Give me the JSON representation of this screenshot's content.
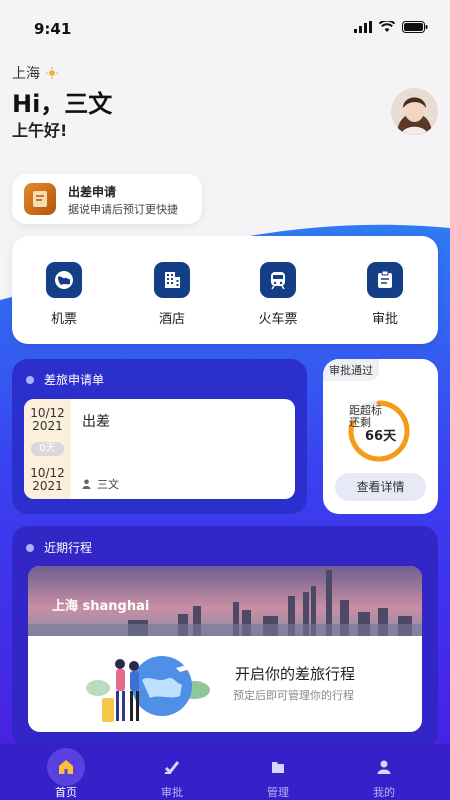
{
  "status": {
    "time": "9:41"
  },
  "header": {
    "location": "上海",
    "greeting": "Hi，三文",
    "subgreeting": "上午好!"
  },
  "apply": {
    "title": "出差申请",
    "subtitle": "据说申请后预订更快捷"
  },
  "services": [
    {
      "label": "机票",
      "icon": "globe-icon"
    },
    {
      "label": "酒店",
      "icon": "hotel-building-icon"
    },
    {
      "label": "火车票",
      "icon": "train-icon"
    },
    {
      "label": "审批",
      "icon": "clipboard-icon"
    }
  ],
  "trip_request": {
    "header": "差旅申请单",
    "start_date": "10/12",
    "start_year": "2021",
    "days": "0天",
    "end_date": "10/12",
    "end_year": "2021",
    "purpose": "出差",
    "person": "三文"
  },
  "approval": {
    "tag": "审批通过",
    "label_line1": "距超标",
    "label_line2": "还剩",
    "days": "66天",
    "button": "查看详情",
    "ring_fraction": 0.8
  },
  "recent": {
    "header": "近期行程",
    "city": "上海 shanghai",
    "title": "开启你的差旅行程",
    "subtitle": "预定后即可管理你的行程"
  },
  "tabs": [
    {
      "label": "首页",
      "active": true
    },
    {
      "label": "审批",
      "active": false
    },
    {
      "label": "管理",
      "active": false
    },
    {
      "label": "我的",
      "active": false
    }
  ],
  "colors": {
    "primary": "#143e86",
    "accent_blue": "#2b2fcc",
    "tab_bg": "#3520c9",
    "ring_orange": "#f49b1a"
  }
}
